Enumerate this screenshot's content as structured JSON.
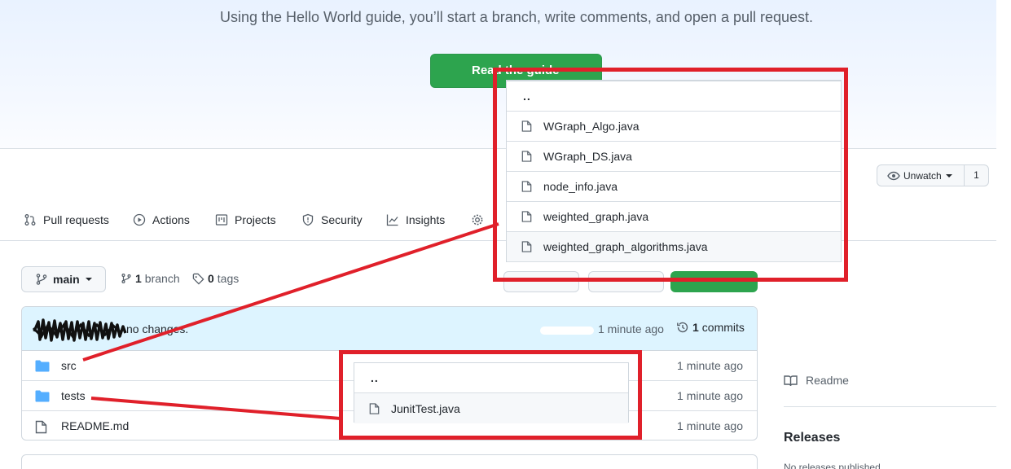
{
  "hero": {
    "text": "Using the Hello World guide, you’ll start a branch, write comments, and open a pull request.",
    "button_label": "Read the guide"
  },
  "watch": {
    "label": "Unwatch",
    "count": "1"
  },
  "tabs": [
    {
      "label": "Pull requests",
      "icon": "pull-request-icon"
    },
    {
      "label": "Actions",
      "icon": "play-icon"
    },
    {
      "label": "Projects",
      "icon": "project-icon"
    },
    {
      "label": "Security",
      "icon": "shield-icon"
    },
    {
      "label": "Insights",
      "icon": "graph-icon"
    }
  ],
  "branch": {
    "name": "main",
    "branches_count": "1",
    "branches_label": "branch",
    "tags_count": "0",
    "tags_label": "tags"
  },
  "commit": {
    "message": "no changes.",
    "time": "1 minute ago",
    "count": "1",
    "count_label": "commits"
  },
  "files": [
    {
      "name": "src",
      "type": "folder",
      "time": "1 minute ago"
    },
    {
      "name": "tests",
      "type": "folder",
      "time": "1 minute ago"
    },
    {
      "name": "README.md",
      "type": "file",
      "time": "1 minute ago"
    }
  ],
  "popup_src": {
    "parent": "..",
    "items": [
      "WGraph_Algo.java",
      "WGraph_DS.java",
      "node_info.java",
      "weighted_graph.java",
      "weighted_graph_algorithms.java"
    ]
  },
  "popup_tests": {
    "parent": "..",
    "items": [
      "JunitTest.java"
    ]
  },
  "sidebar": {
    "readme": "Readme",
    "releases_title": "Releases",
    "no_releases": "No releases published"
  },
  "colors": {
    "accent_green": "#2da44e",
    "annotation_red": "#e0202a",
    "folder_blue": "#54aeff"
  }
}
